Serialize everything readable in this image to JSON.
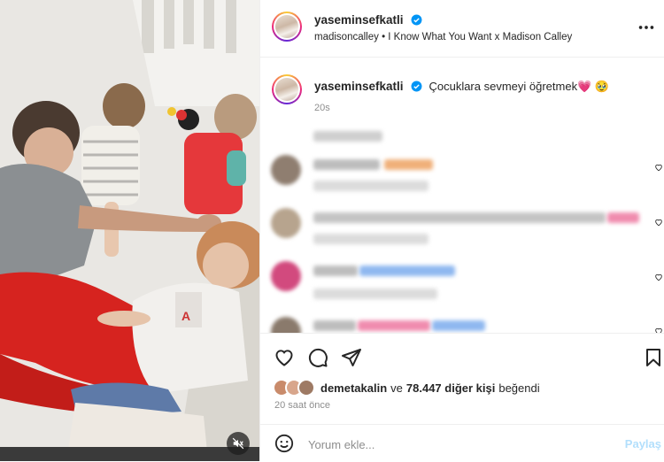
{
  "header": {
    "username": "yaseminsefkatli",
    "audio": "madisoncalley • I Know What You Want x Madison Calley"
  },
  "caption": {
    "username": "yaseminsefkatli",
    "text": "Çocuklara sevmeyi öğretmek💗 🥹",
    "time": "20s"
  },
  "likes": {
    "first_user": "demetakalin",
    "connector": "ve",
    "others": "78.447 diğer kişi",
    "suffix": "beğendi"
  },
  "posted_ago": "20 saat önce",
  "comment_box": {
    "placeholder": "Yorum ekle...",
    "post_label": "Paylaş"
  },
  "colors": {
    "accent": "#0095f6",
    "verified": "#0095f6",
    "post_disabled": "#b2dffc",
    "heart": "#f0509a"
  },
  "icons": [
    "heart-icon",
    "comment-icon",
    "share-icon",
    "bookmark-icon",
    "more-icon",
    "emoji-icon",
    "mute-icon",
    "verified-icon"
  ]
}
